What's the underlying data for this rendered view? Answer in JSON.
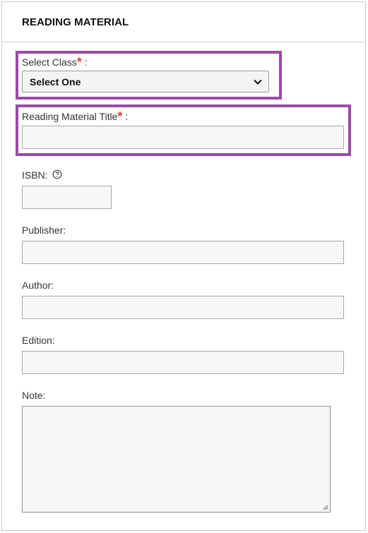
{
  "panel": {
    "title": "READING MATERIAL"
  },
  "fields": {
    "select_class": {
      "label": "Select Class",
      "required": "*",
      "colon": ":",
      "value": "Select One"
    },
    "title": {
      "label": "Reading Material Title",
      "required": "*",
      "colon": ":",
      "value": ""
    },
    "isbn": {
      "label": "ISBN:",
      "value": ""
    },
    "publisher": {
      "label": "Publisher:",
      "value": ""
    },
    "author": {
      "label": "Author:",
      "value": ""
    },
    "edition": {
      "label": "Edition:",
      "value": ""
    },
    "note": {
      "label": "Note:",
      "value": ""
    }
  },
  "colors": {
    "highlight": "#9b4aa6",
    "required": "#e0473a"
  },
  "icons": {
    "help": "question-circle-icon",
    "dropdown": "chevron-down-icon",
    "resize": "resize-grip-icon"
  }
}
